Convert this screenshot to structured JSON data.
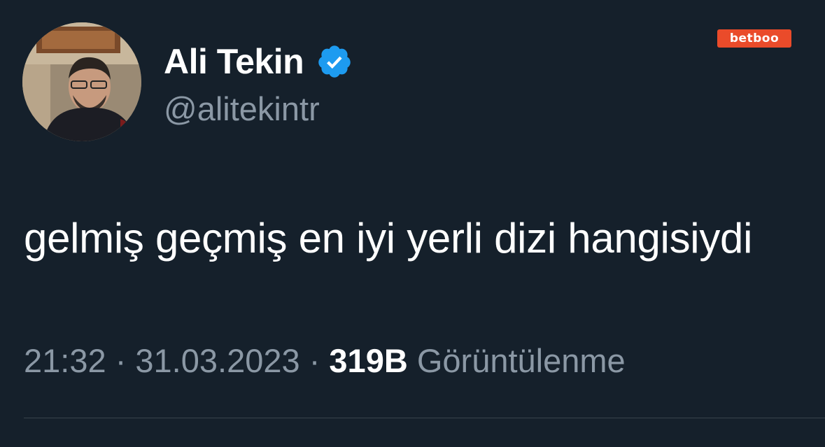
{
  "author": {
    "display_name": "Ali Tekin",
    "handle": "@alitekintr",
    "verified_icon": "verified-badge-icon",
    "avatar_icon": "profile-photo"
  },
  "tweet": {
    "text": "gelmiş geçmiş en iyi yerli dizi hangisiydi",
    "time": "21:32",
    "separator": "·",
    "date": "31.03.2023",
    "views_count": "319B",
    "views_label": "Görüntülenme"
  },
  "watermark": {
    "text": "betboo"
  },
  "colors": {
    "background": "#15202b",
    "primary_text": "#ffffff",
    "secondary_text": "#8b98a5",
    "verified_blue": "#1d9bf0",
    "watermark_bg": "#ea4b2a",
    "divider": "#38444d"
  }
}
